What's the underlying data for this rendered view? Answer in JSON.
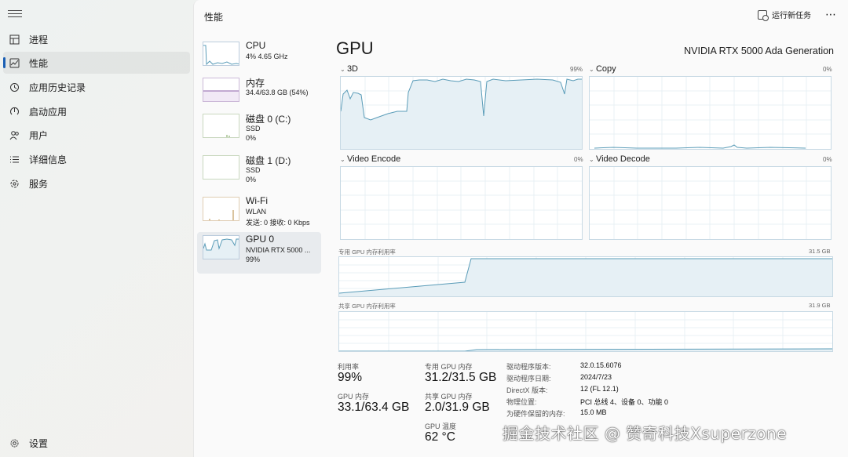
{
  "nav": {
    "items": [
      {
        "label": "进程",
        "icon": "processes-icon"
      },
      {
        "label": "性能",
        "icon": "performance-icon"
      },
      {
        "label": "应用历史记录",
        "icon": "app-history-icon"
      },
      {
        "label": "启动应用",
        "icon": "startup-apps-icon"
      },
      {
        "label": "用户",
        "icon": "users-icon"
      },
      {
        "label": "详细信息",
        "icon": "details-icon"
      },
      {
        "label": "服务",
        "icon": "services-icon"
      }
    ],
    "settings_label": "设置"
  },
  "header": {
    "title": "性能",
    "run_task_label": "运行新任务",
    "more_label": "⋯"
  },
  "resources": [
    {
      "name": "CPU",
      "sub1": "4% 4.65 GHz",
      "sub2": ""
    },
    {
      "name": "内存",
      "sub1": "34.4/63.8 GB (54%)",
      "sub2": ""
    },
    {
      "name": "磁盘 0 (C:)",
      "sub1": "SSD",
      "sub2": "0%"
    },
    {
      "name": "磁盘 1 (D:)",
      "sub1": "SSD",
      "sub2": "0%"
    },
    {
      "name": "Wi-Fi",
      "sub1": "WLAN",
      "sub2": "发送: 0 接收: 0 Kbps"
    },
    {
      "name": "GPU 0",
      "sub1": "NVIDIA RTX 5000 ...",
      "sub2": "99%"
    }
  ],
  "gpu": {
    "title": "GPU",
    "model": "NVIDIA RTX 5000 Ada Generation",
    "engines": [
      {
        "label": "3D",
        "pct": "99%"
      },
      {
        "label": "Copy",
        "pct": "0%"
      },
      {
        "label": "Video Encode",
        "pct": "0%"
      },
      {
        "label": "Video Decode",
        "pct": "0%"
      }
    ],
    "dedicated_memory_label": "专用 GPU 内存利用率",
    "dedicated_memory_max": "31.5 GB",
    "shared_memory_label": "共享 GPU 内存利用率",
    "shared_memory_max": "31.9 GB"
  },
  "stats": {
    "utilization": {
      "label": "利用率",
      "value": "99%"
    },
    "gpu_memory": {
      "label": "GPU 内存",
      "value": "33.1/63.4 GB"
    },
    "dedicated": {
      "label": "专用 GPU 内存",
      "value": "31.2/31.5 GB"
    },
    "shared": {
      "label": "共享 GPU 内存",
      "value": "2.0/31.9 GB"
    },
    "temperature": {
      "label": "GPU 温度",
      "value": "62 °C"
    }
  },
  "info": [
    {
      "key": "驱动程序版本:",
      "value": "32.0.15.6076"
    },
    {
      "key": "驱动程序日期:",
      "value": "2024/7/23"
    },
    {
      "key": "DirectX 版本:",
      "value": "12 (FL 12.1)"
    },
    {
      "key": "物理位置:",
      "value": "PCI 总线 4、设备 0、功能 0"
    },
    {
      "key": "为硬件保留的内存:",
      "value": "15.0 MB"
    }
  ],
  "watermark": "掘金技术社区 @ 赞奇科技Xsuperzone",
  "colors": {
    "accent": "#1a5fb4",
    "graph_line": "#5a9cb8",
    "graph_fill": "#e6f0f5"
  }
}
